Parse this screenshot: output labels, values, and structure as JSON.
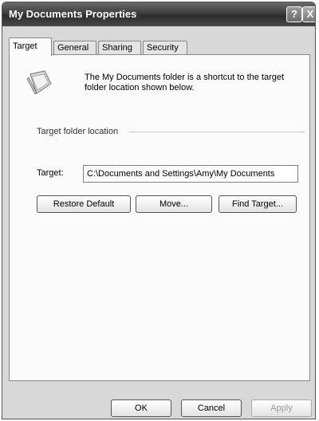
{
  "window": {
    "title": "My Documents Properties",
    "help_button": "?",
    "close_button": "X"
  },
  "tabs": [
    {
      "label": "Target",
      "active": true
    },
    {
      "label": "General",
      "active": false
    },
    {
      "label": "Sharing",
      "active": false
    },
    {
      "label": "Security",
      "active": false
    }
  ],
  "target_tab": {
    "icon": "my-documents-folder-icon",
    "description": "The My Documents folder is a shortcut to the target folder location shown below.",
    "group_label": "Target folder location",
    "target_label": "Target:",
    "target_value": "C:\\Documents and Settings\\Amy\\My Documents",
    "buttons": {
      "restore_default": "Restore Default",
      "move": "Move...",
      "find_target": "Find Target..."
    }
  },
  "footer": {
    "ok": "OK",
    "cancel": "Cancel",
    "apply": "Apply"
  }
}
